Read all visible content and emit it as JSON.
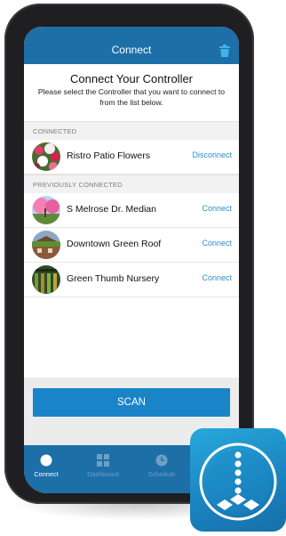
{
  "header": {
    "title": "Connect"
  },
  "intro": {
    "heading": "Connect Your Controller",
    "instructions": "Please select the Controller that you want to connect to from the list below."
  },
  "connected": {
    "label": "CONNECTED",
    "items": [
      {
        "name": "Ristro Patio Flowers",
        "action": "Disconnect"
      }
    ]
  },
  "previously": {
    "label": "PREVIOUSLY CONNECTED",
    "items": [
      {
        "name": "S Melrose Dr. Median",
        "action": "Connect"
      },
      {
        "name": "Downtown Green Roof",
        "action": "Connect"
      },
      {
        "name": "Green Thumb Nursery",
        "action": "Connect"
      }
    ]
  },
  "scan": {
    "label": "SCAN"
  },
  "tabs": [
    {
      "label": "Connect",
      "icon": "dot-icon",
      "active": true
    },
    {
      "label": "Dashboard",
      "icon": "dashboard-grid-icon",
      "active": false
    },
    {
      "label": "Schedule",
      "icon": "clock-icon",
      "active": false
    }
  ],
  "icons": {
    "header_action": "trash-icon",
    "app_logo": "sprinkler-droplets-icon"
  },
  "colors": {
    "primary": "#1d6fa8",
    "scan_button": "#1984c7",
    "link": "#2d8ccc",
    "tab_active": "#ffffff",
    "tab_inactive": "#6f9fc5"
  }
}
